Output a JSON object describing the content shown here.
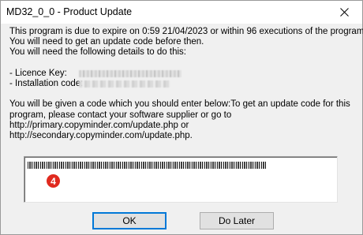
{
  "window": {
    "title": "MD32_0_0 - Product Update",
    "close_icon": "close-icon"
  },
  "message": {
    "lines": [
      "This program is due to expire on 0:59  21/04/2023 or within 96 executions of the program.",
      "You will need to get an update code before then.",
      "You will need the following details to do this:"
    ],
    "licence_key_label": "- Licence Key:",
    "installation_code_label": "- Installation code:",
    "instructions": [
      "You will be given a code which you should enter below:To get an update code for this",
      "program, please contact your software supplier or go to",
      "http://primary.copyminder.com/update.php or",
      "http://secondary.copyminder.com/update.php."
    ]
  },
  "code_input": {
    "marker": "4"
  },
  "buttons": {
    "ok": "OK",
    "do_later": "Do Later"
  }
}
